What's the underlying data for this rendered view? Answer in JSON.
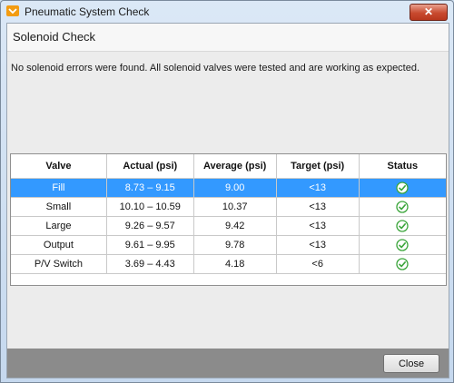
{
  "window": {
    "title": "Pneumatic System Check",
    "close_glyph": "✕"
  },
  "section": {
    "title": "Solenoid Check"
  },
  "message": "No solenoid errors were found. All solenoid valves were tested and are working as expected.",
  "table": {
    "headers": [
      "Valve",
      "Actual (psi)",
      "Average (psi)",
      "Target (psi)",
      "Status"
    ],
    "rows": [
      {
        "valve": "Fill",
        "actual": "8.73 – 9.15",
        "average": "9.00",
        "target": "<13",
        "status": "ok-icon",
        "selected": true
      },
      {
        "valve": "Small",
        "actual": "10.10 – 10.59",
        "average": "10.37",
        "target": "<13",
        "status": "ok-icon",
        "selected": false
      },
      {
        "valve": "Large",
        "actual": "9.26 – 9.57",
        "average": "9.42",
        "target": "<13",
        "status": "ok-icon",
        "selected": false
      },
      {
        "valve": "Output",
        "actual": "9.61 – 9.95",
        "average": "9.78",
        "target": "<13",
        "status": "ok-icon",
        "selected": false
      },
      {
        "valve": "P/V Switch",
        "actual": "3.69 – 4.43",
        "average": "4.18",
        "target": "<6",
        "status": "ok-icon",
        "selected": false
      }
    ]
  },
  "footer": {
    "close_label": "Close"
  },
  "colors": {
    "selection": "#3399ff",
    "check": "#3aa53a",
    "close_x": "#c84a2f"
  }
}
